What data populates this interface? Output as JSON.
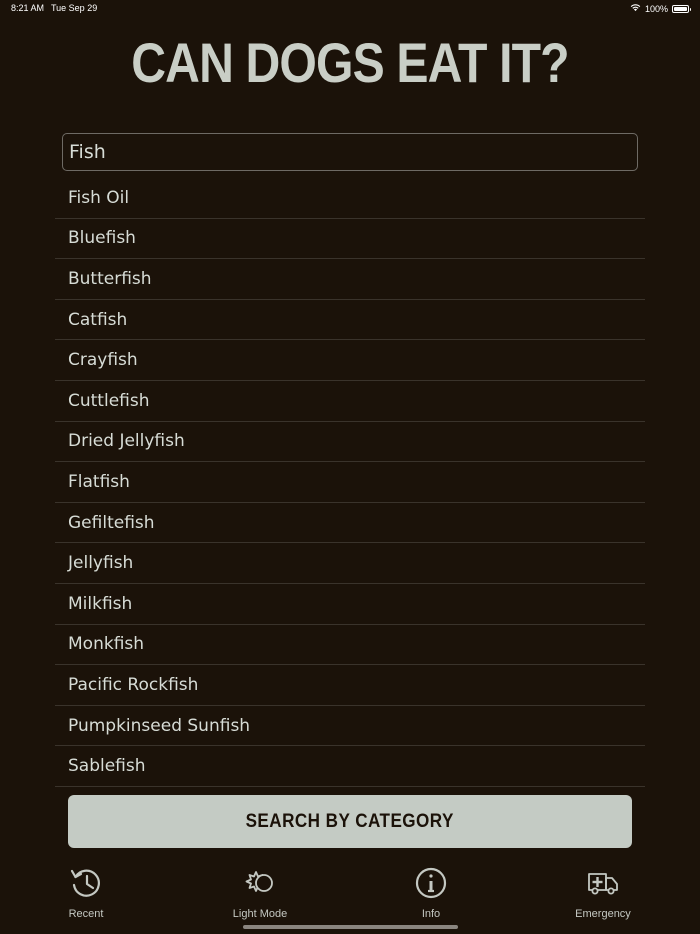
{
  "status_bar": {
    "time": "8:21 AM",
    "date": "Tue Sep 29",
    "battery": "100%",
    "battery_level": 1.0
  },
  "title": "CAN DOGS EAT IT?",
  "search": {
    "value": "Fish",
    "placeholder": ""
  },
  "results": [
    "Fish Oil",
    "Bluefish",
    "Butterfish",
    "Catfish",
    "Crayfish",
    "Cuttlefish",
    "Dried Jellyfish",
    "Flatfish",
    "Gefiltefish",
    "Jellyfish",
    "Milkfish",
    "Monkfish",
    "Pacific Rockfish",
    "Pumpkinseed Sunfish",
    "Sablefish"
  ],
  "category_button": "SEARCH BY CATEGORY",
  "tabs": [
    {
      "label": "Recent",
      "icon": "history-icon"
    },
    {
      "label": "Light Mode",
      "icon": "light-mode-icon"
    },
    {
      "label": "Info",
      "icon": "info-icon"
    },
    {
      "label": "Emergency",
      "icon": "ambulance-icon"
    }
  ],
  "colors": {
    "background": "#1b1209",
    "title": "#c9cec6",
    "text": "#d7dcd6",
    "button_bg": "#c4cbc4"
  }
}
